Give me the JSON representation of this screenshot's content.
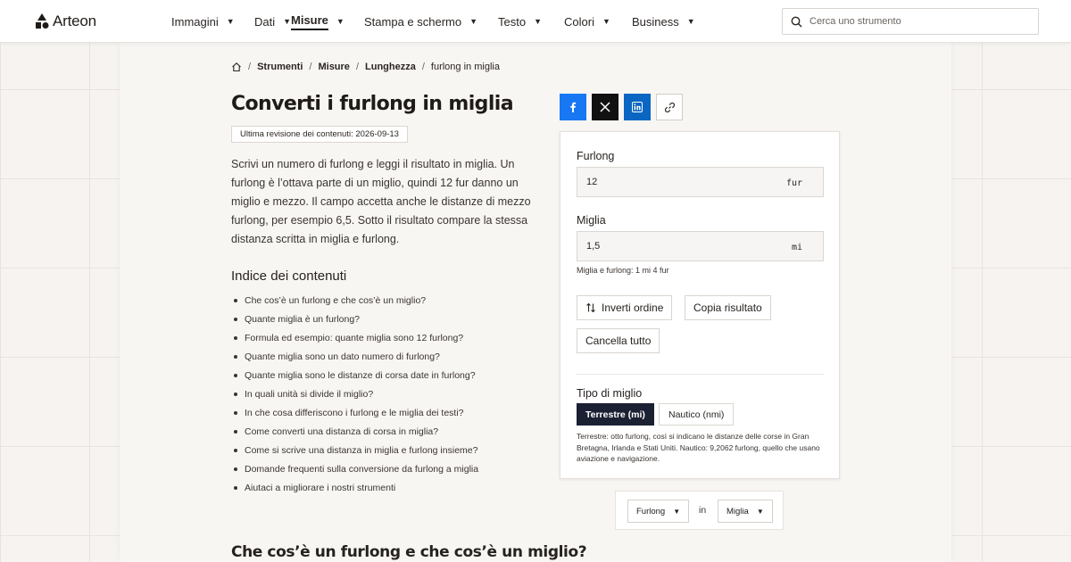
{
  "app": {
    "name": "Arteon"
  },
  "nav": {
    "items": [
      {
        "label": "Immagini",
        "active": false
      },
      {
        "label": "Dati",
        "active": false
      },
      {
        "label": "Misure",
        "active": true
      },
      {
        "label": "Stampa e schermo",
        "active": false
      },
      {
        "label": "Testo",
        "active": false
      },
      {
        "label": "Colori",
        "active": false
      },
      {
        "label": "Business",
        "active": false
      }
    ]
  },
  "search": {
    "placeholder": "Cerca uno strumento",
    "icon": "search-icon"
  },
  "breadcrumb": [
    "Strumenti",
    "Misure",
    "Lunghezza",
    "furlong in miglia"
  ],
  "page": {
    "title": "Converti i furlong in miglia",
    "revision": "Ultima revisione dei contenuti: 2026-09-13",
    "intro": "Scrivi un numero di furlong e leggi il risultato in miglia. Un furlong è l’ottava parte di un miglio, quindi 12 fur danno un miglio e mezzo. Il campo accetta anche le distanze di mezzo furlong, per esempio 6,5. Sotto il risultato compare la stessa distanza scritta in miglia e furlong.",
    "toc_title": "Indice dei contenuti",
    "toc": [
      "Che cos’è un furlong e che cos’è un miglio?",
      "Quante miglia è un furlong?",
      "Formula ed esempio: quante miglia sono 12 furlong?",
      "Quante miglia sono un dato numero di furlong?",
      "Quante miglia sono le distanze di corsa date in furlong?",
      "In quali unità si divide il miglio?",
      "In che cosa differiscono i furlong e le miglia dei testi?",
      "Come converti una distanza di corsa in miglia?",
      "Come si scrive una distanza in miglia e furlong insieme?",
      "Domande frequenti sulla conversione da furlong a miglia",
      "Aiutaci a migliorare i nostri strumenti"
    ],
    "section_heading": "Che cos’è un furlong e che cos’è un miglio?"
  },
  "share": [
    "facebook-icon",
    "x-icon",
    "linkedin-icon",
    "link-icon"
  ],
  "converter": {
    "from_label": "Furlong",
    "from_value": "12",
    "from_unit": "fur",
    "to_label": "Miglia",
    "to_value": "1,5",
    "to_unit": "mi",
    "hint": "Miglia e furlong: 1 mi 4 fur",
    "swap_label": "Inverti ordine",
    "copy_label": "Copia risultato",
    "clear_label": "Cancella tutto",
    "mode_title": "Tipo di miglio",
    "mode_on": "Terrestre (mi)",
    "mode_off": "Nautico (nmi)",
    "note": "Terrestre: otto furlong, così si indicano le distanze delle corse in Gran Bretagna, Irlanda e Stati Uniti. Nautico: 9,2062 furlong, quello che usano aviazione e navigazione."
  },
  "picker": {
    "from": "Furlong",
    "in": "in",
    "to": "Miglia"
  },
  "colors": {
    "accent_dark": "#1c2033",
    "facebook": "#1877f2",
    "linkedin": "#0a66c2"
  }
}
